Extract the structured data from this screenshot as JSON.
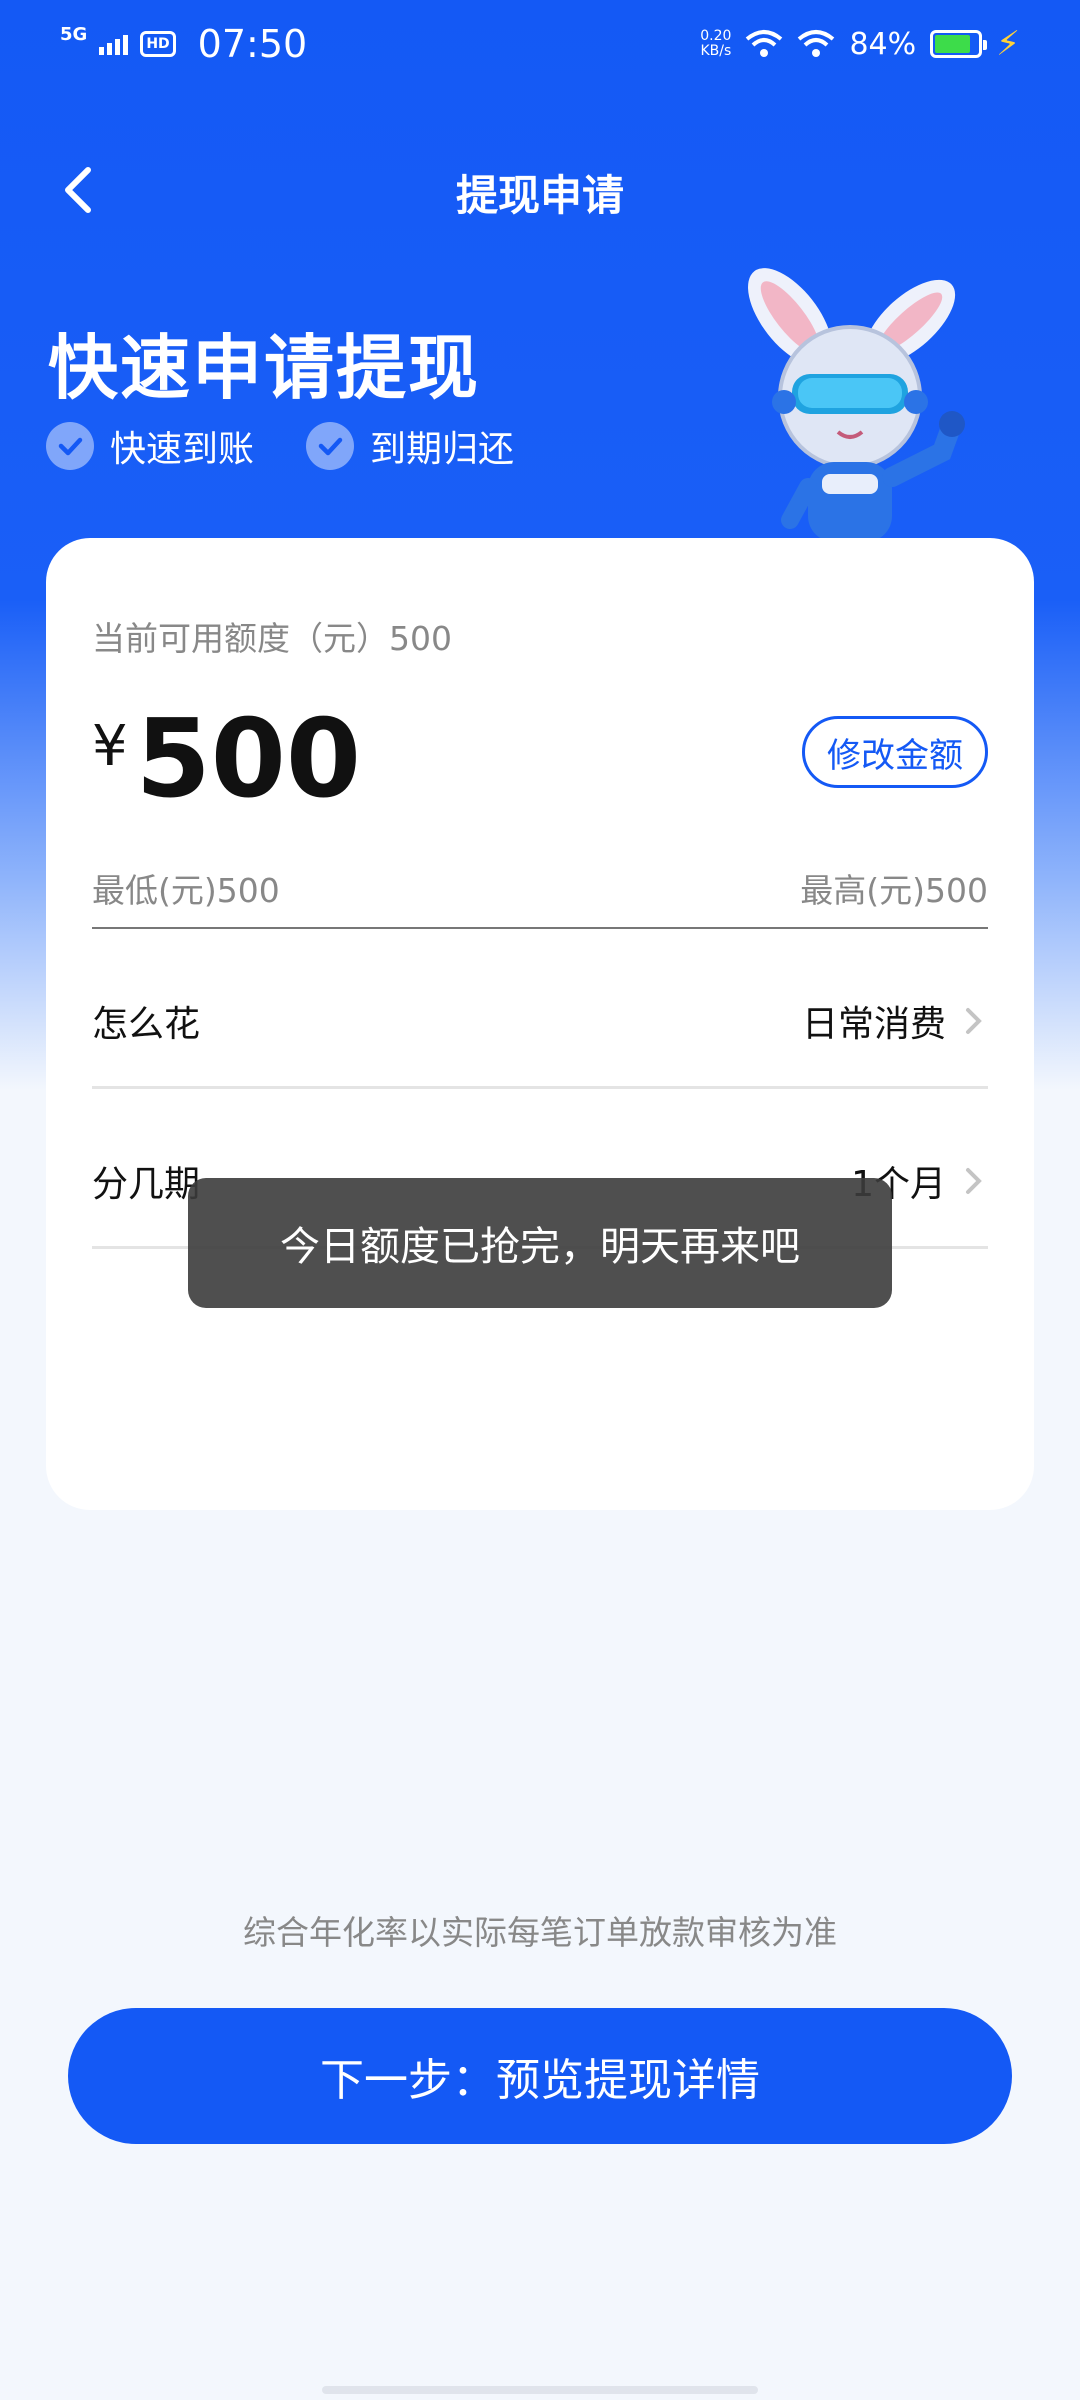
{
  "status_bar": {
    "network": "5G",
    "hd": "HD",
    "time": "07:50",
    "speed_value": "0.20",
    "speed_unit": "KB/s",
    "battery": "84%"
  },
  "header": {
    "title": "提现申请",
    "back_icon": "chevron-left-icon"
  },
  "hero": {
    "title": "快速申请提现",
    "tags": [
      "快速到账",
      "到期归还"
    ]
  },
  "card": {
    "limit_label": "当前可用额度（元）500",
    "currency": "¥",
    "amount": "500",
    "modify_label": "修改金额",
    "min_label": "最低(元)500",
    "max_label": "最高(元)500",
    "options": [
      {
        "label": "怎么花",
        "value": "日常消费"
      },
      {
        "label": "分几期",
        "value": "1个月"
      }
    ]
  },
  "toast": {
    "message": "今日额度已抢完，明天再来吧"
  },
  "footer": {
    "disclaimer": "综合年化率以实际每笔订单放款审核为准",
    "next_button": "下一步：预览提现详情"
  },
  "colors": {
    "primary": "#1459f5",
    "background": "#f3f7fd",
    "toast_bg": "#3c3c3c"
  }
}
